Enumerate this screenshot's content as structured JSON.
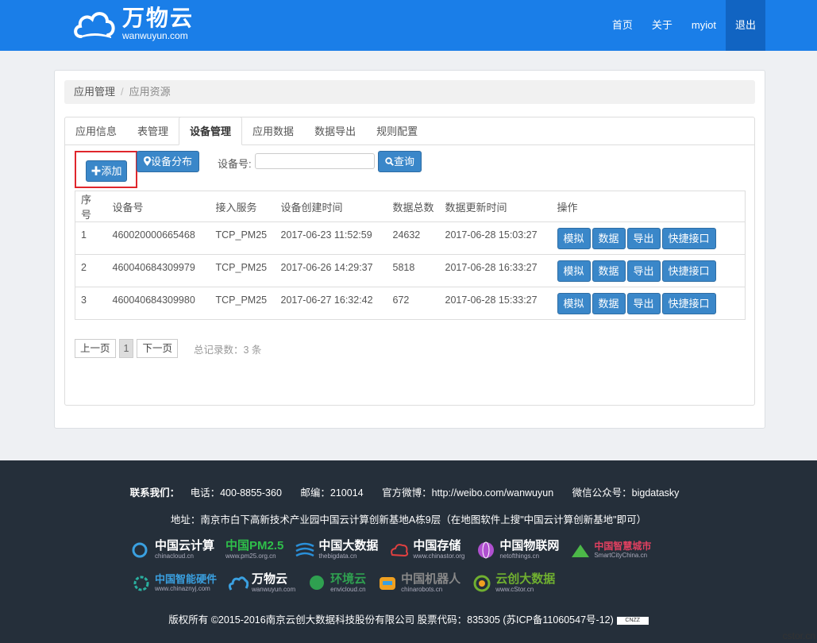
{
  "brand": {
    "name_cn": "万物云",
    "name_en": "wanwuyun.com"
  },
  "nav": [
    {
      "label": "首页"
    },
    {
      "label": "关于"
    },
    {
      "label": "myiot"
    },
    {
      "label": "退出"
    }
  ],
  "breadcrumb": {
    "parent": "应用管理",
    "current": "应用资源",
    "separator": "/"
  },
  "tabs": [
    {
      "label": "应用信息"
    },
    {
      "label": "表管理"
    },
    {
      "label": "设备管理"
    },
    {
      "label": "应用数据"
    },
    {
      "label": "数据导出"
    },
    {
      "label": "规则配置"
    }
  ],
  "toolbar": {
    "add_label": "添加",
    "distribution_label": "设备分布",
    "device_no_label": "设备号:",
    "device_no_value": "",
    "query_label": "查询"
  },
  "table": {
    "headers": [
      "序号",
      "设备号",
      "接入服务",
      "设备创建时间",
      "数据总数",
      "数据更新时间",
      "操作"
    ],
    "rows": [
      {
        "no": "1",
        "device": "460020000665468",
        "service": "TCP_PM25",
        "created": "2017-06-23 11:52:59",
        "count": "24632",
        "updated": "2017-06-28 15:03:27"
      },
      {
        "no": "2",
        "device": "460040684309979",
        "service": "TCP_PM25",
        "created": "2017-06-26 14:29:37",
        "count": "5818",
        "updated": "2017-06-28 16:33:27"
      },
      {
        "no": "3",
        "device": "460040684309980",
        "service": "TCP_PM25",
        "created": "2017-06-27 16:32:42",
        "count": "672",
        "updated": "2017-06-28 15:33:27"
      }
    ],
    "actions": [
      "模拟",
      "数据",
      "导出",
      "快捷接口"
    ]
  },
  "pager": {
    "prev": "上一页",
    "page": "1",
    "next": "下一页",
    "total": "总记录数：3 条"
  },
  "footer": {
    "contact_label": "联系我们：",
    "phone": "电话：400-8855-360",
    "postcode": "邮编：210014",
    "weibo": "官方微博：http://weibo.com/wanwuyun",
    "wechat": "微信公众号：bigdatasky",
    "address": "地址：南京市白下高新技术产业园中国云计算创新基地A栋9层（在地图软件上搜\"中国云计算创新基地\"即可）",
    "logos_row1": [
      {
        "cn": "中国云计算",
        "en": "chinacloud.cn",
        "color": "#3aa0e0"
      },
      {
        "cn": "中国PM2.5",
        "en": "www.pm25.org.cn",
        "color": "#2fbf4a"
      },
      {
        "cn": "中国大数据",
        "en": "thebigdata.cn",
        "color": "#2a8fd8"
      },
      {
        "cn": "中国存储",
        "en": "www.chinastor.org",
        "color": "#e04040"
      },
      {
        "cn": "中国物联网",
        "en": "netofthings.cn",
        "color": "#b050d0"
      },
      {
        "cn": "中国智慧城市",
        "en": "SmartCityChina.cn",
        "color": "#4cb848"
      }
    ],
    "logos_row2": [
      {
        "cn": "中国智能硬件",
        "en": "www.chinaznyj.com",
        "color": "#2ab0a0"
      },
      {
        "cn": "万物云",
        "en": "wanwuyun.com",
        "color": "#3aa0e0"
      },
      {
        "cn": "环境云",
        "en": "envicloud.cn",
        "color": "#2fa050"
      },
      {
        "cn": "中国机器人",
        "en": "chinarobots.cn",
        "color": "#f0a020"
      },
      {
        "cn": "云创大数据",
        "en": "www.cStor.cn",
        "color": "#70b030"
      }
    ],
    "copyright": "版权所有 ©2015-2016南京云创大数据科技股份有限公司 股票代码：835305 (苏ICP备11060547号-12)",
    "cnzz": "CNZZ"
  },
  "watermark": "cstor.cn",
  "colors": {
    "header": "#1a7ee8",
    "primary_button": "#3a87c9",
    "highlight_box": "#e0262c",
    "footer": "#252f3a"
  }
}
